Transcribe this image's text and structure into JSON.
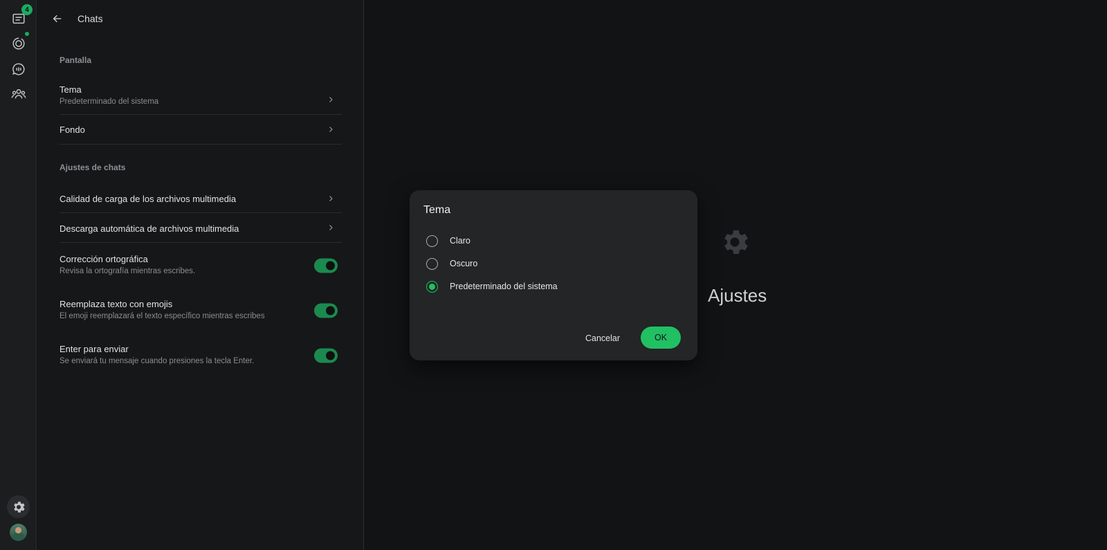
{
  "rail": {
    "chats_badge": "4",
    "icons": [
      "chats-icon",
      "status-icon",
      "channels-icon",
      "communities-icon",
      "settings-icon",
      "avatar"
    ]
  },
  "panel": {
    "title": "Chats",
    "display_section": "Pantalla",
    "theme": {
      "title": "Tema",
      "subtitle": "Predeterminado del sistema"
    },
    "wallpaper": {
      "title": "Fondo"
    },
    "chat_settings_section": "Ajustes de chats",
    "media_upload_quality": {
      "title": "Calidad de carga de los archivos multimedia"
    },
    "media_auto_download": {
      "title": "Descarga automática de archivos multimedia"
    },
    "spell_check": {
      "title": "Corrección ortográfica",
      "subtitle": "Revisa la ortografía mientras escribes.",
      "enabled": true
    },
    "replace_emoji": {
      "title": "Reemplaza texto con emojis",
      "subtitle": "El emoji reemplazará el texto específico mientras escribes",
      "enabled": true
    },
    "enter_to_send": {
      "title": "Enter para enviar",
      "subtitle": "Se enviará tu mensaje cuando presiones la tecla Enter.",
      "enabled": true
    }
  },
  "placeholder": {
    "title": "Ajustes"
  },
  "dialog": {
    "title": "Tema",
    "options": [
      {
        "label": "Claro",
        "selected": false
      },
      {
        "label": "Oscuro",
        "selected": false
      },
      {
        "label": "Predeterminado del sistema",
        "selected": true
      }
    ],
    "cancel_label": "Cancelar",
    "ok_label": "OK"
  },
  "colors": {
    "accent": "#21c063",
    "toggle_on": "#1b8a4f",
    "background": "#111314"
  }
}
